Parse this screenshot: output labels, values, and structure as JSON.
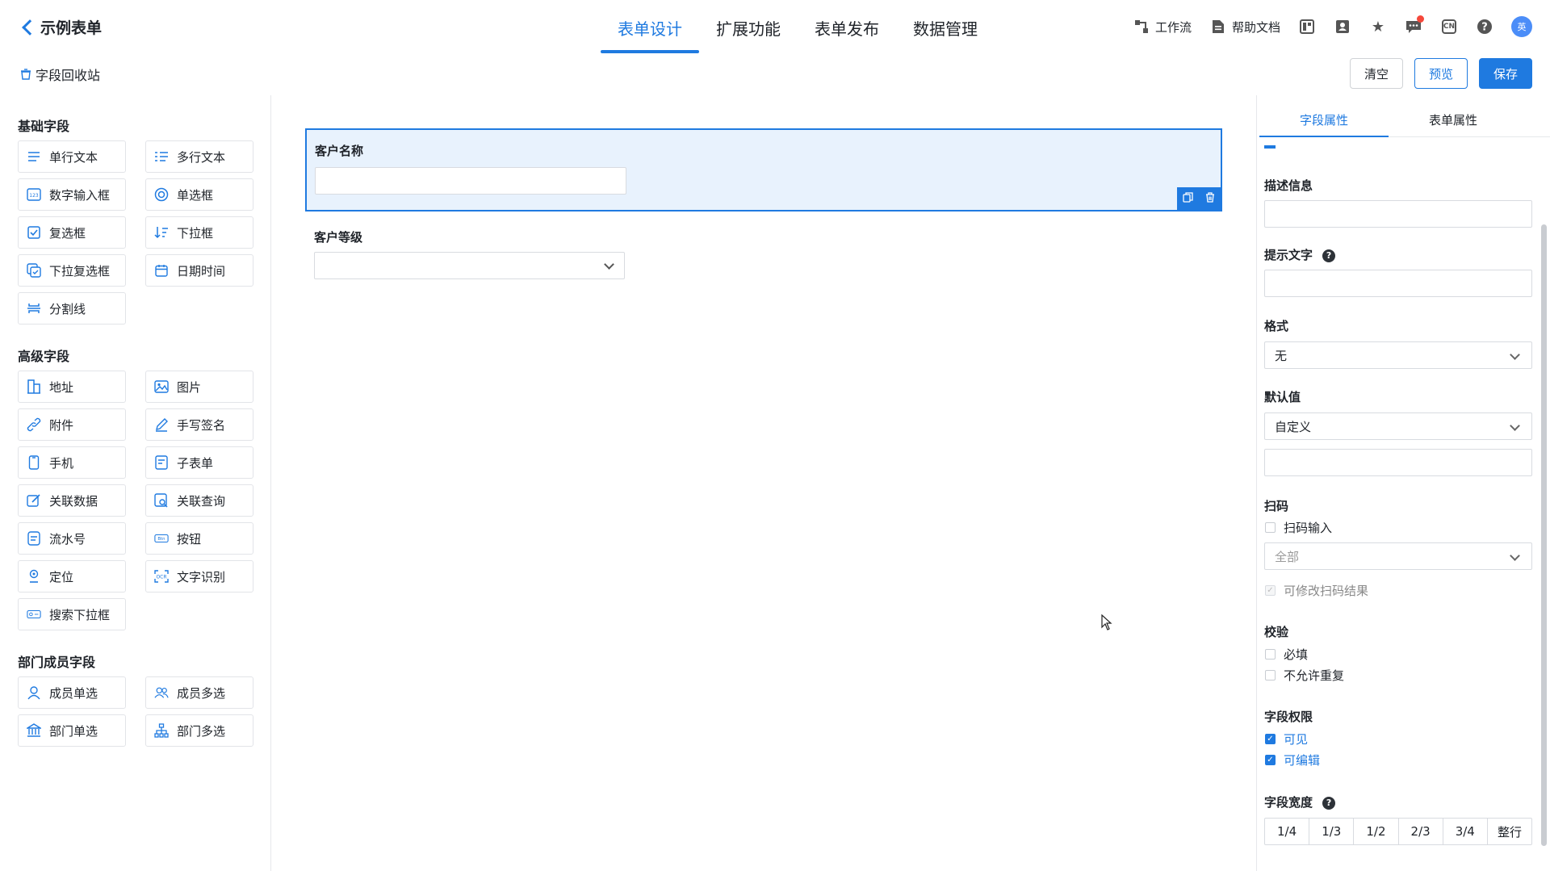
{
  "header": {
    "back_title": "示例表单",
    "tabs": [
      {
        "label": "表单设计",
        "active": true
      },
      {
        "label": "扩展功能",
        "active": false
      },
      {
        "label": "表单发布",
        "active": false
      },
      {
        "label": "数据管理",
        "active": false
      }
    ],
    "workflow_label": "工作流",
    "help_label": "帮助文档",
    "lang_label": "CN",
    "avatar_text": "英"
  },
  "toolbar": {
    "recycle_label": "字段回收站",
    "clear_label": "清空",
    "preview_label": "预览",
    "save_label": "保存"
  },
  "palette": {
    "basic": {
      "title": "基础字段",
      "items": [
        "单行文本",
        "多行文本",
        "数字输入框",
        "单选框",
        "复选框",
        "下拉框",
        "下拉复选框",
        "日期时间",
        "分割线"
      ]
    },
    "advanced": {
      "title": "高级字段",
      "items": [
        "地址",
        "图片",
        "附件",
        "手写签名",
        "手机",
        "子表单",
        "关联数据",
        "关联查询",
        "流水号",
        "按钮",
        "定位",
        "文字识别",
        "搜索下拉框"
      ]
    },
    "member": {
      "title": "部门成员字段",
      "items": [
        "成员单选",
        "成员多选",
        "部门单选",
        "部门多选"
      ]
    }
  },
  "canvas": {
    "fields": [
      {
        "label": "客户名称",
        "type": "text",
        "selected": true
      },
      {
        "label": "客户等级",
        "type": "select",
        "selected": false
      }
    ]
  },
  "props": {
    "tabs": [
      "字段属性",
      "表单属性"
    ],
    "desc_label": "描述信息",
    "hint_label": "提示文字",
    "format_label": "格式",
    "format_value": "无",
    "default_label": "默认值",
    "default_value": "自定义",
    "scan_label": "扫码",
    "scan_input": "扫码输入",
    "scan_scope": "全部",
    "scan_editable": "可修改扫码结果",
    "validate_label": "校验",
    "required": "必填",
    "no_dup": "不允许重复",
    "perm_label": "字段权限",
    "visible": "可见",
    "editable": "可编辑",
    "width_label": "字段宽度",
    "widths": [
      "1/4",
      "1/3",
      "1/2",
      "2/3",
      "3/4",
      "整行"
    ]
  }
}
